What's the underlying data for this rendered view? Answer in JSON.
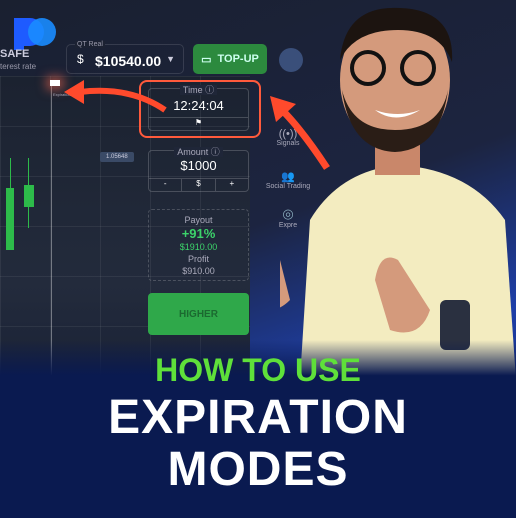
{
  "header": {
    "safe_label": "SAFE",
    "safe_sub": "terest rate",
    "account_label": "QT Real",
    "balance": "$10540.00",
    "topup_label": "TOP-UP"
  },
  "chart": {
    "expiration_label": "Expiration time",
    "price_tag": "1.05648"
  },
  "trade": {
    "time_label": "Time ⓘ",
    "time_value": "12:24:04",
    "amount_label": "Amount ⓘ",
    "amount_value": "$1000",
    "minus": "-",
    "currency": "$",
    "plus": "+",
    "payout_label": "Payout",
    "payout_pct": "+91%",
    "payout_value": "$1910.00",
    "profit_label": "Profit",
    "profit_value": "$910.00",
    "higher_label": "HIGHER"
  },
  "sidebar": {
    "signals": "Signals",
    "social": "Social Trading",
    "express": "Expre"
  },
  "headline": {
    "line1": "HOW TO USE",
    "line2": "EXPIRATION",
    "line3": "MODES"
  },
  "colors": {
    "highlight": "#ff5a3c",
    "green": "#5fe03a",
    "brand": "#1e5bff"
  }
}
